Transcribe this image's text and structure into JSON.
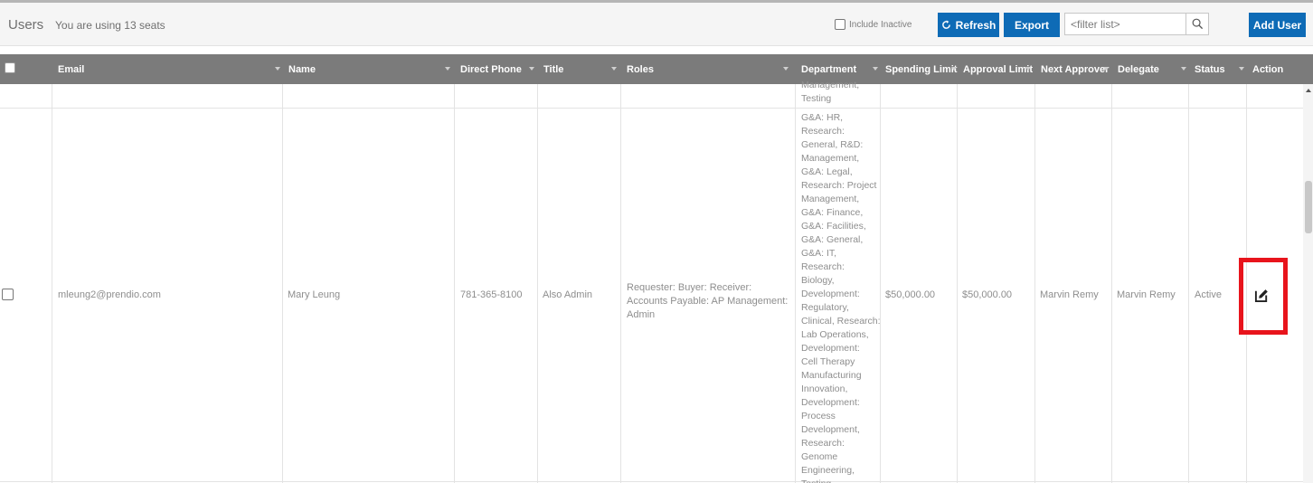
{
  "toolbar": {
    "title": "Users",
    "seats_text": "You are using 13 seats",
    "include_inactive_label": "Include Inactive",
    "refresh_label": "Refresh",
    "export_label": "Export",
    "filter_placeholder": "<filter list>",
    "add_user_label": "Add User"
  },
  "columns": [
    "Email",
    "Name",
    "Direct Phone",
    "Title",
    "Roles",
    "Department",
    "Spending Limit",
    "Approval Limit",
    "Next Approver",
    "Delegate",
    "Status",
    "Action"
  ],
  "prev_row": {
    "department_tail": "Management,\nTesting"
  },
  "row": {
    "email": "mleung2@prendio.com",
    "name": "Mary Leung",
    "direct_phone": "781-365-8100",
    "title": "Also Admin",
    "roles": "Requester: Buyer: Receiver: Accounts Payable: AP Management: Admin",
    "department": "G&A: HR,\nResearch:\nGeneral, R&D:\nManagement,\nG&A: Legal,\nResearch: Project\nManagement,\nG&A: Finance,\nG&A: Facilities,\nG&A: General,\nG&A: IT,\nResearch:\nBiology,\nDevelopment:\nRegulatory,\nClinical, Research:\nLab Operations,\nDevelopment:\nCell Therapy\nManufacturing\nInnovation,\nDevelopment:\nProcess\nDevelopment,\nResearch:\nGenome\nEngineering,\nTesting",
    "spending_limit": "$50,000.00",
    "approval_limit": "$50,000.00",
    "next_approver": "Marvin Remy",
    "delegate": "Marvin Remy",
    "status": "Active",
    "action_icon": "edit-icon"
  },
  "colors": {
    "header_bg": "#7b7b7b",
    "button_bg": "#0e6bb6",
    "highlight": "#e8141c"
  }
}
